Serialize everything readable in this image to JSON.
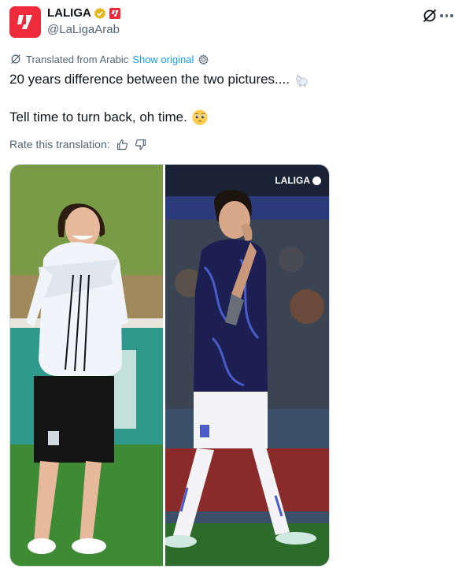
{
  "account": {
    "name": "LALIGA",
    "handle": "@LaLigaArab",
    "verified_color": "#e2b719",
    "badge_color": "#ee2b3a",
    "avatar_color": "#ee2b3a"
  },
  "icons": {
    "grok": "grok-icon",
    "more": "more-horizontal-icon",
    "translate": "translate-icon",
    "settings": "gear-icon",
    "thumb_up": "thumbs-up-icon",
    "thumb_down": "thumbs-down-icon"
  },
  "translation": {
    "label": "Translated from Arabic",
    "show_original": "Show original"
  },
  "tweet": {
    "line1": "20 years difference between the two pictures....",
    "line1_emoji": "goat",
    "line2": "Tell time to turn back, oh time.",
    "line2_emoji": "pleading-face"
  },
  "rate": {
    "label": "Rate this translation:"
  },
  "media": {
    "watermark": "LALIGA",
    "left_photo": "young player in white training jacket and black shorts laughing on a training pitch",
    "right_photo": "older player in dark purple patterned kit and white shorts covering mouth in a stadium at night"
  },
  "colors": {
    "link": "#1d9bf0",
    "secondary_text": "#536471",
    "primary_text": "#0f1419"
  }
}
